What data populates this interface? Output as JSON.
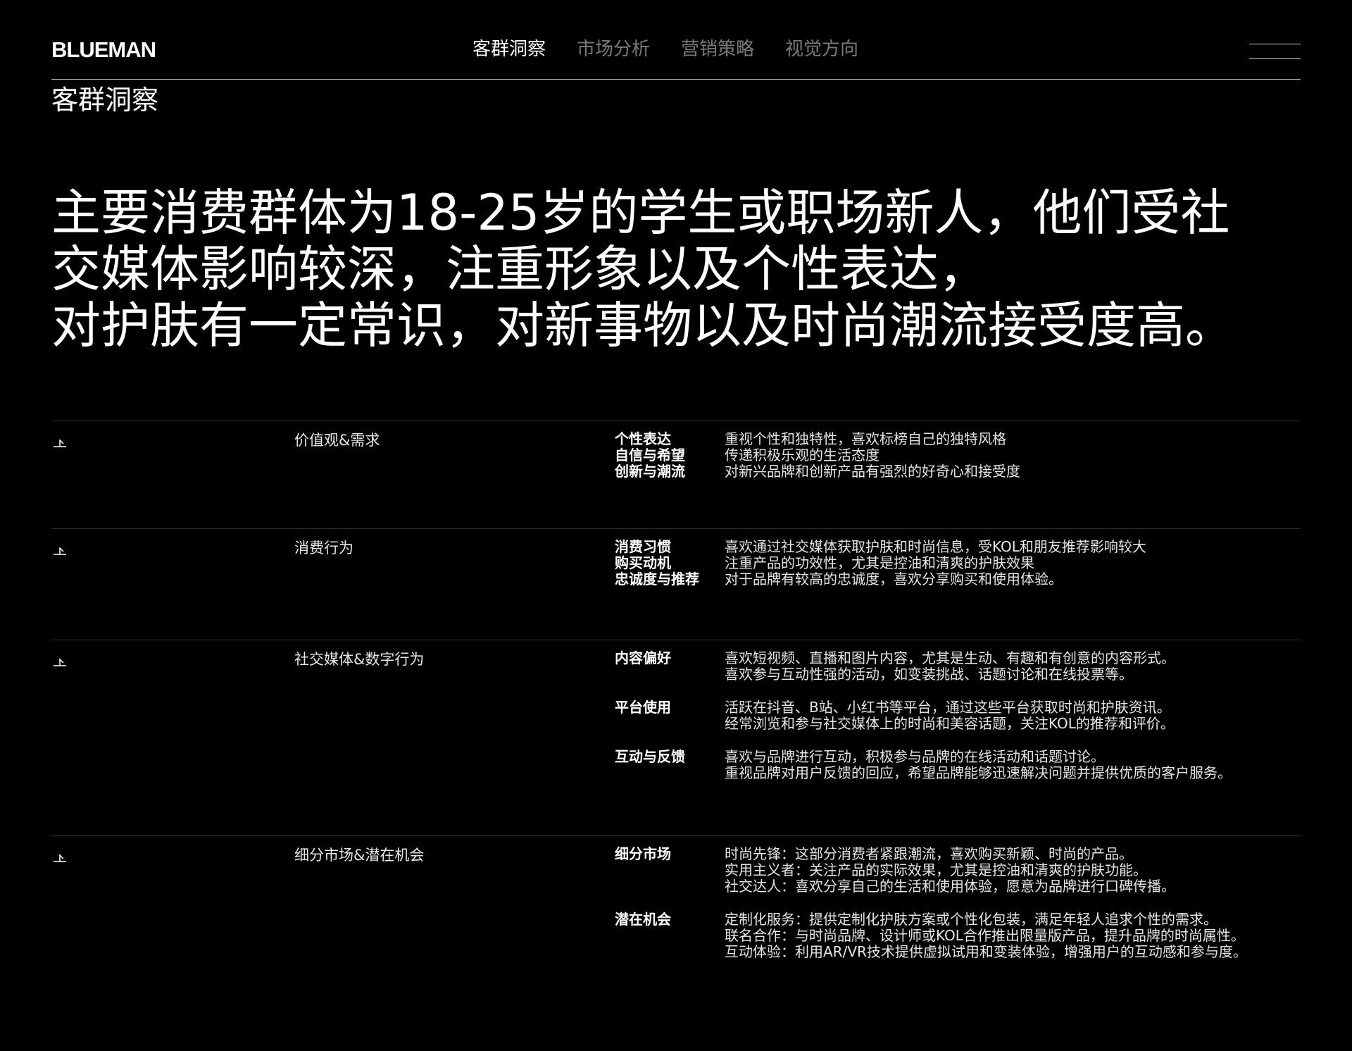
{
  "header": {
    "logo": "BLUEMAN",
    "nav": [
      {
        "label": "客群洞察",
        "active": true
      },
      {
        "label": "市场分析",
        "active": false
      },
      {
        "label": "营销策略",
        "active": false
      },
      {
        "label": "视觉方向",
        "active": false
      }
    ]
  },
  "section_label": "客群洞察",
  "headline": [
    "主要消费群体为18-25岁的学生或职场新人，他们受社",
    "交媒体影响较深，注重形象以及个性表达，",
    "对护肤有一定常识，对新事物以及时尚潮流接受度高。"
  ],
  "rows": [
    {
      "category": "价值观&需求",
      "pairs": [
        {
          "term": "个性表达",
          "desc": "重视个性和独特性，喜欢标榜自己的独特风格"
        },
        {
          "term": "自信与希望",
          "desc": "传递积极乐观的生活态度"
        },
        {
          "term": "创新与潮流",
          "desc": "对新兴品牌和创新产品有强烈的好奇心和接受度"
        }
      ]
    },
    {
      "category": "消费行为",
      "pairs": [
        {
          "term": "消费习惯",
          "desc": "喜欢通过社交媒体获取护肤和时尚信息，受KOL和朋友推荐影响较大"
        },
        {
          "term": "购买动机",
          "desc": "注重产品的功效性，尤其是控油和清爽的护肤效果"
        },
        {
          "term": "忠诚度与推荐",
          "desc": "对于品牌有较高的忠诚度，喜欢分享购买和使用体验。"
        }
      ]
    },
    {
      "category": "社交媒体&数字行为",
      "groups": [
        {
          "term": "内容偏好",
          "lines": [
            "喜欢短视频、直播和图片内容，尤其是生动、有趣和有创意的内容形式。",
            "喜欢参与互动性强的活动，如变装挑战、话题讨论和在线投票等。"
          ]
        },
        {
          "term": "平台使用",
          "lines": [
            "活跃在抖音、B站、小红书等平台，通过这些平台获取时尚和护肤资讯。",
            "经常浏览和参与社交媒体上的时尚和美容话题，关注KOL的推荐和评价。"
          ]
        },
        {
          "term": "互动与反馈",
          "lines": [
            "喜欢与品牌进行互动，积极参与品牌的在线活动和话题讨论。",
            "重视品牌对用户反馈的回应，希望品牌能够迅速解决问题并提供优质的客户服务。"
          ]
        }
      ]
    },
    {
      "category": "细分市场&潜在机会",
      "groups": [
        {
          "term": "细分市场",
          "lines": [
            "时尚先锋：这部分消费者紧跟潮流，喜欢购买新颖、时尚的产品。",
            "实用主义者：关注产品的实际效果，尤其是控油和清爽的护肤功能。",
            "社交达人：喜欢分享自己的生活和使用体验，愿意为品牌进行口碑传播。"
          ]
        },
        {
          "term": "潜在机会",
          "lines": [
            "定制化服务：提供定制化护肤方案或个性化包装，满足年轻人追求个性的需求。",
            "联名合作：与时尚品牌、设计师或KOL合作推出限量版产品，提升品牌的时尚属性。",
            "互动体验：利用AR/VR技术提供虚拟试用和变装体验，增强用户的互动感和参与度。"
          ]
        }
      ]
    }
  ]
}
